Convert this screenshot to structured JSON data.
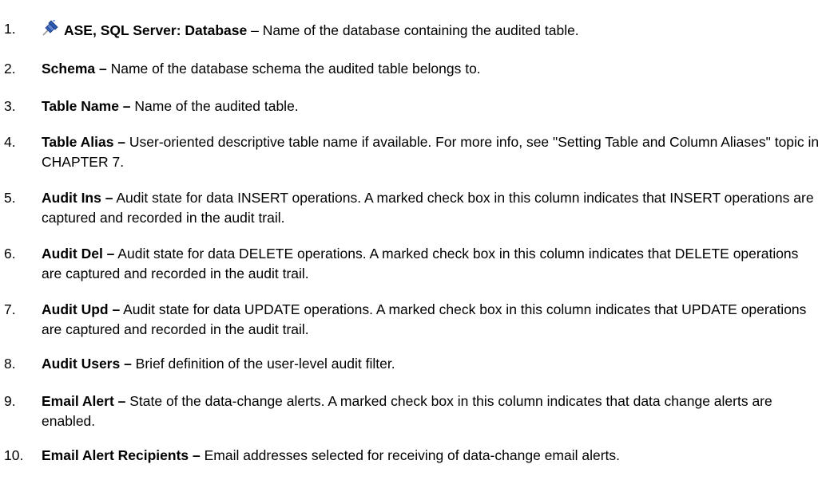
{
  "items": [
    {
      "number": "1.",
      "term": "ASE, SQL Server:  Database",
      "description": " – Name of the database containing the audited table.",
      "icon": "pushpin-icon"
    },
    {
      "number": "2.",
      "term": "Schema –",
      "description": " Name of the database schema the audited table belongs to."
    },
    {
      "number": "3.",
      "term": "Table Name –",
      "description": " Name of the audited table."
    },
    {
      "number": "4.",
      "term": "Table Alias –",
      "description": " User-oriented descriptive table name if available. For more info, see \"Setting Table and Column Aliases\" topic in CHAPTER 7."
    },
    {
      "number": "5.",
      "term": "Audit Ins –",
      "description": " Audit state for data INSERT operations. A marked check box in this column indicates that INSERT operations are captured and recorded in the audit trail."
    },
    {
      "number": "6.",
      "term": "Audit Del –",
      "description": " Audit state for data DELETE operations. A marked check box in this column indicates that DELETE operations are captured and recorded in the audit trail."
    },
    {
      "number": "7.",
      "term": "Audit Upd –",
      "description": " Audit state for data UPDATE operations. A marked check box in this column indicates that UPDATE operations are captured and recorded in the audit trail."
    },
    {
      "number": "8.",
      "term": "Audit Users –",
      "description": " Brief definition of the user-level audit filter."
    },
    {
      "number": "9.",
      "term": "Email Alert –",
      "description": " State of the data-change alerts. A marked check box in this column indicates that data change alerts are enabled."
    },
    {
      "number": "10.",
      "term": "Email Alert Recipients –",
      "description": " Email addresses selected for receiving of data-change email alerts."
    }
  ]
}
